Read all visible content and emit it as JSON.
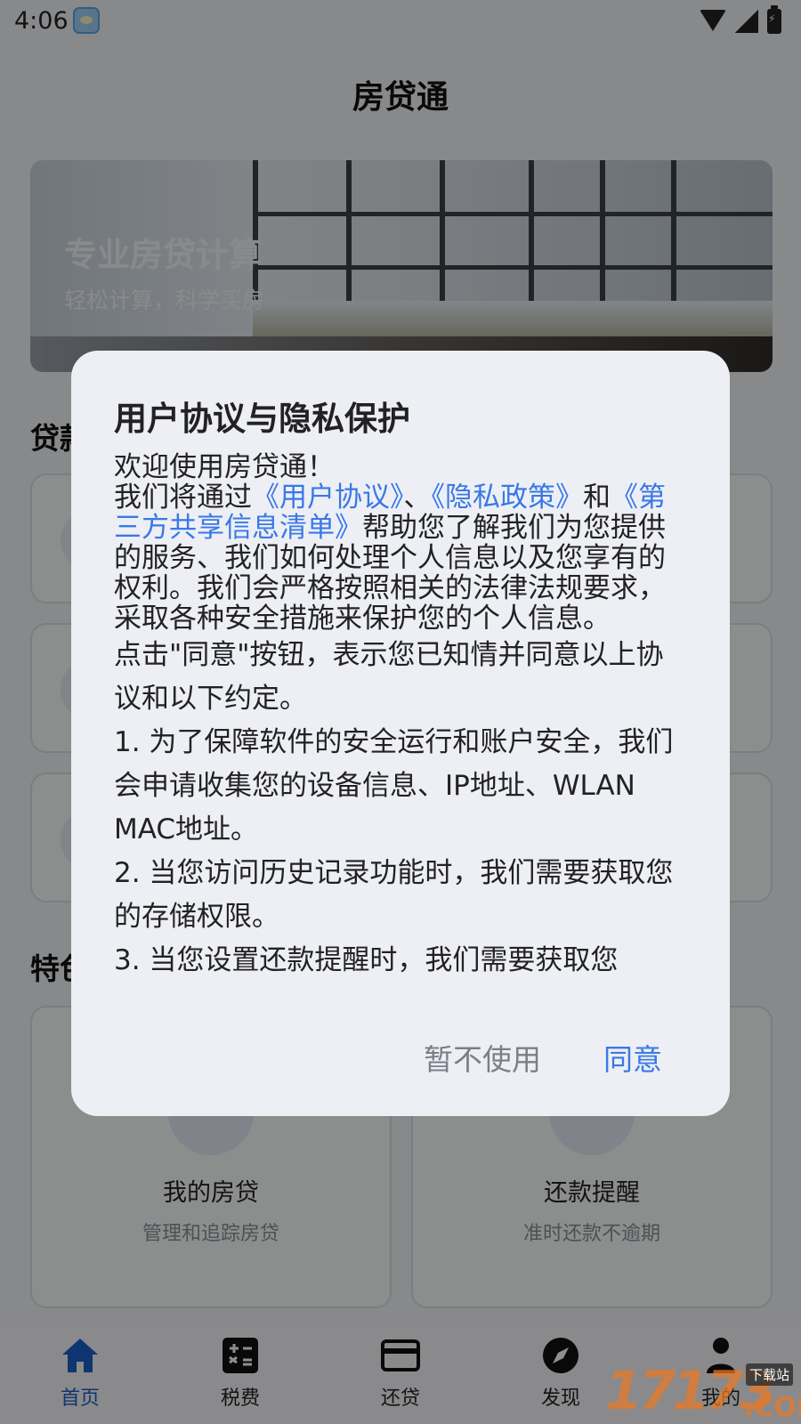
{
  "status_bar": {
    "time": "4:06"
  },
  "header": {
    "title": "房贷通"
  },
  "banner": {
    "title": "专业房贷计算",
    "subtitle": "轻松计算，科学买房"
  },
  "sections": {
    "loan_types_title_visible": "贷款",
    "features_title_visible": "特色"
  },
  "feature_cards": [
    {
      "title": "我的房贷",
      "desc": "管理和追踪房贷"
    },
    {
      "title": "还款提醒",
      "desc": "准时还款不逾期"
    }
  ],
  "bottom_nav": [
    {
      "label": "首页",
      "icon": "home-icon",
      "active": true
    },
    {
      "label": "税费",
      "icon": "calculator-icon",
      "active": false
    },
    {
      "label": "还贷",
      "icon": "credit-card-icon",
      "active": false
    },
    {
      "label": "发现",
      "icon": "compass-icon",
      "active": false
    },
    {
      "label": "我的",
      "icon": "person-icon",
      "active": false
    }
  ],
  "dialog": {
    "title": "用户协议与隐私保护",
    "welcome": "欢迎使用房贷通！",
    "intro_prefix": "我们将通过",
    "link_user_agreement": "《用户协议》",
    "sep1": "、",
    "link_privacy_policy": "《隐私政策》",
    "and": "和",
    "link_third_party": "《第三方共享信息清单》",
    "intro_suffix": "帮助您了解我们为您提供的服务、我们如何处理个人信息以及您享有的权利。我们会严格按照相关的法律法规要求，采取各种安全措施来保护您的个人信息。",
    "consent_text": "点击\"同意\"按钮，表示您已知情并同意以上协议和以下约定。",
    "item1": "1. 为了保障软件的安全运行和账户安全，我们会申请收集您的设备信息、IP地址、WLAN MAC地址。",
    "item2": "2. 当您访问历史记录功能时，我们需要获取您的存储权限。",
    "item3": "3. 当您设置还款提醒时，我们需要获取您",
    "cancel_label": "暂不使用",
    "agree_label": "同意",
    "link_color": "#3978e6"
  },
  "watermark": {
    "number": "17173",
    "tag": "下载站",
    "suffix": ".COM"
  }
}
